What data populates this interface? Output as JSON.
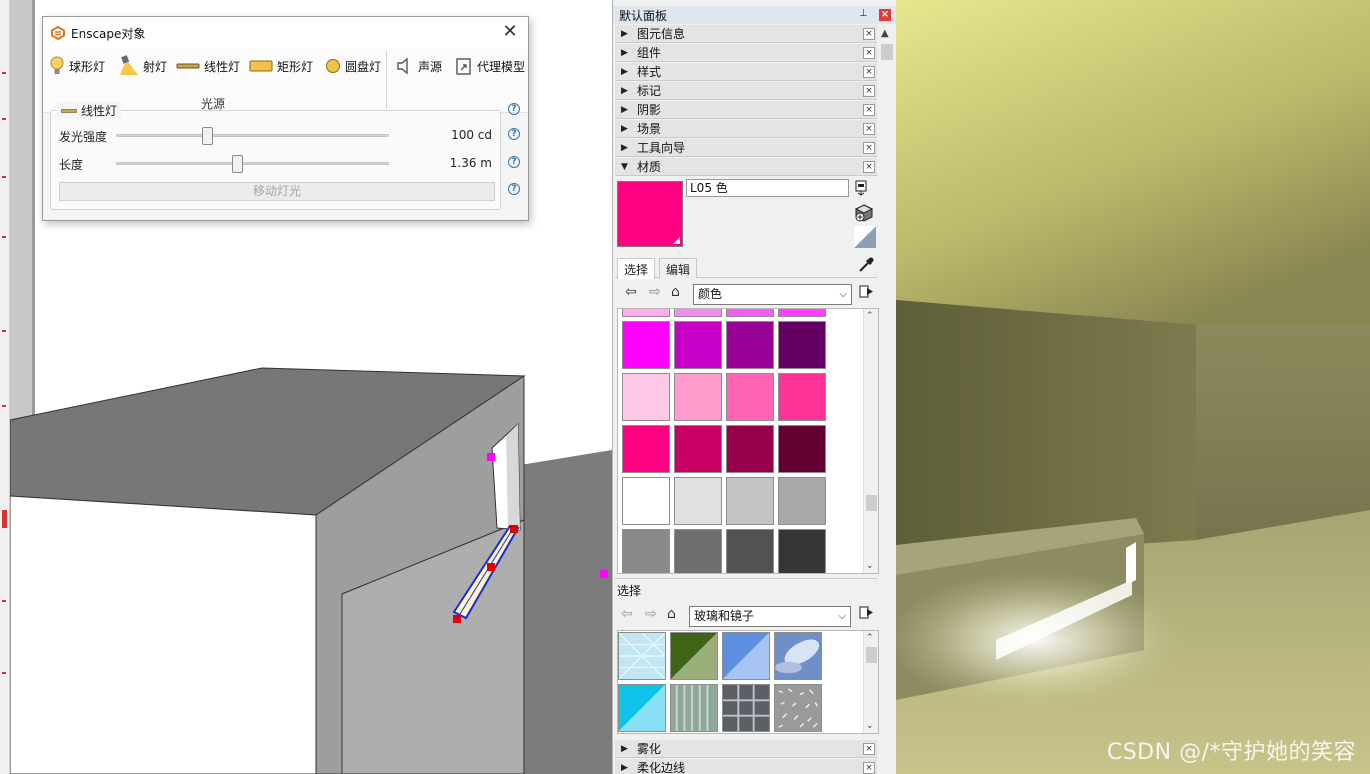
{
  "enscape_dialog": {
    "title": "Enscape对象",
    "tools": [
      {
        "label": "球形灯",
        "icon": "bulb-icon"
      },
      {
        "label": "射灯",
        "icon": "spotlight-icon"
      },
      {
        "label": "线性灯",
        "icon": "line-light-icon"
      },
      {
        "label": "矩形灯",
        "icon": "rect-light-icon"
      },
      {
        "label": "圆盘灯",
        "icon": "disk-light-icon"
      },
      {
        "label": "声源",
        "icon": "speaker-icon"
      },
      {
        "label": "代理模型",
        "icon": "proxy-model-icon"
      }
    ],
    "group_label": "光源",
    "light_type": "线性灯",
    "intensity_label": "发光强度",
    "intensity_value": "100 cd",
    "intensity_slider_fraction": 0.33,
    "length_label": "长度",
    "length_value": "1.36 m",
    "length_slider_fraction": 0.44,
    "move_light_label": "移动灯光",
    "help_symbol": "?"
  },
  "tray": {
    "title": "默认面板",
    "pin_symbol": "⊥",
    "close_symbol": "×",
    "sections": [
      {
        "label": "图元信息",
        "expanded": false
      },
      {
        "label": "组件",
        "expanded": false
      },
      {
        "label": "样式",
        "expanded": false
      },
      {
        "label": "标记",
        "expanded": false
      },
      {
        "label": "阴影",
        "expanded": false
      },
      {
        "label": "场景",
        "expanded": false
      },
      {
        "label": "工具向导",
        "expanded": false
      },
      {
        "label": "材质",
        "expanded": true
      }
    ],
    "bottom_sections": [
      {
        "label": "雾化",
        "expanded": false
      },
      {
        "label": "柔化边线",
        "expanded": false
      }
    ],
    "material": {
      "color": "#ff0080",
      "name": "L05 色",
      "tabs": [
        "选择",
        "编辑"
      ],
      "collection": "颜色",
      "second_label": "选择",
      "second_collection": "玻璃和镜子",
      "color_rows": [
        [
          "#ffaaf0",
          "#f28cf0",
          "#f25ef0",
          "#ff3cff"
        ],
        [
          "#ff00ff",
          "#c800c8",
          "#960096",
          "#640064"
        ],
        [
          "#ffc8e6",
          "#ff9ccd",
          "#ff64b4",
          "#ff3296"
        ],
        [
          "#ff0080",
          "#c80064",
          "#96004b",
          "#640032"
        ],
        [
          "#ffffff",
          "#e0e0e0",
          "#c4c4c4",
          "#a8a8a8"
        ],
        [
          "#8a8a8a",
          "#6e6e6e",
          "#525252",
          "#363636"
        ]
      ]
    }
  },
  "render": {
    "watermark": "CSDN @/*守护她的笑容"
  }
}
